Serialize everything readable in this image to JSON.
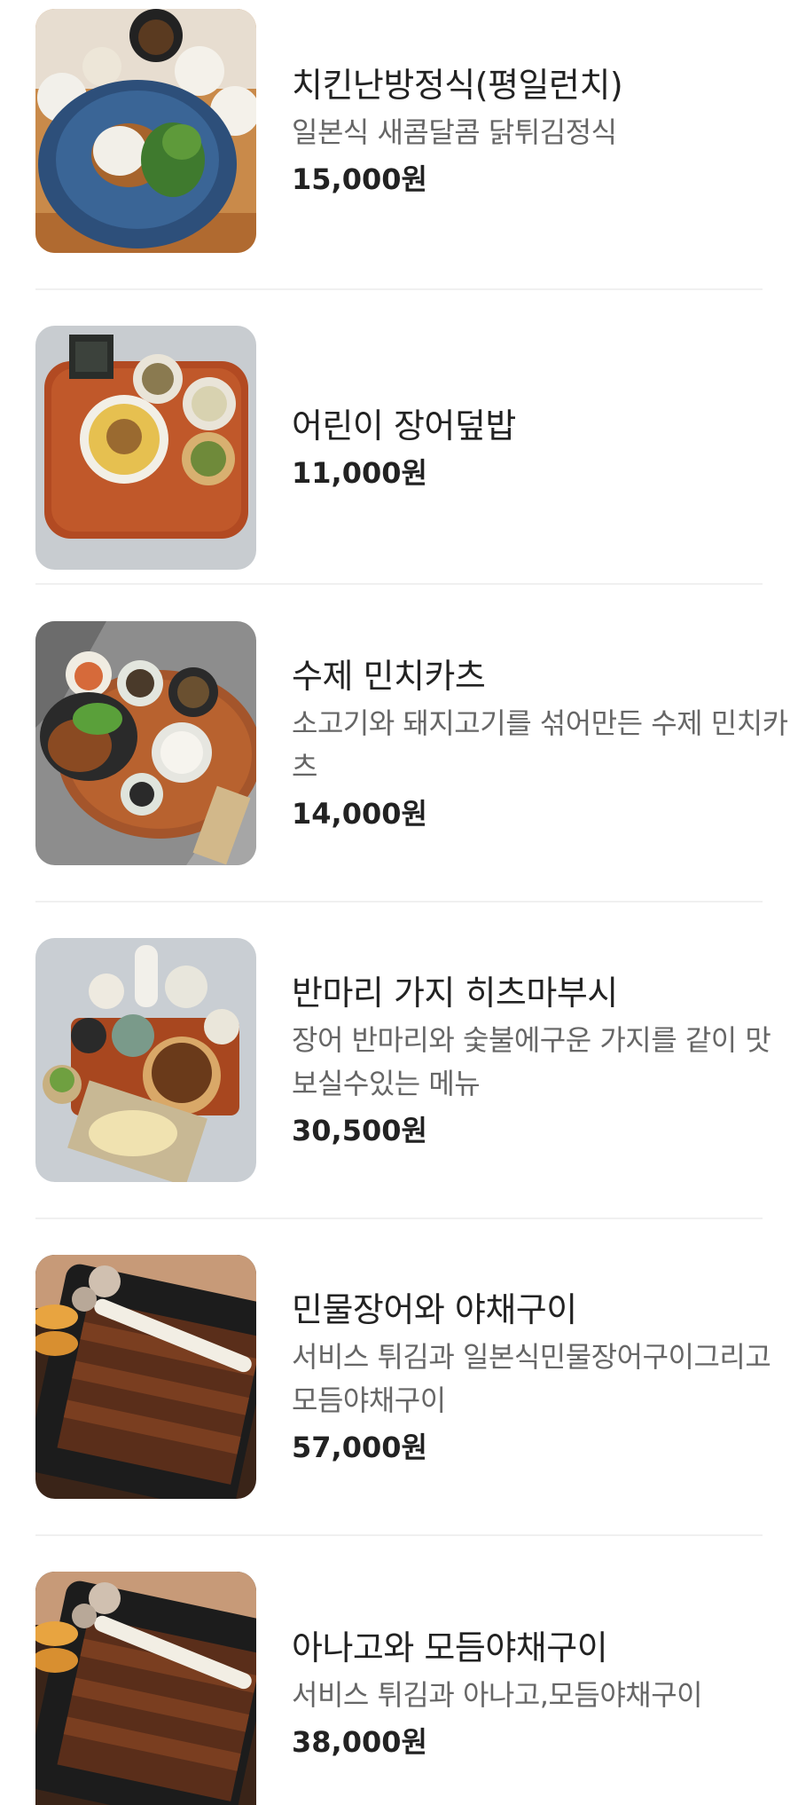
{
  "menu": {
    "items": [
      {
        "name": "치킨난방정식(평일런치)",
        "description": "일본식 새콤달콤 닭튀김정식",
        "price": "15,000원",
        "photo": "chicken-nanban-set-photo"
      },
      {
        "name": "어린이 장어덮밥",
        "description": "",
        "price": "11,000원",
        "photo": "kids-eel-rice-bowl-photo"
      },
      {
        "name": "수제 민치카츠",
        "description": "소고기와 돼지고기를 섞어만든 수제 민치카츠",
        "price": "14,000원",
        "photo": "menchi-katsu-set-photo"
      },
      {
        "name": "반마리 가지 히츠마부시",
        "description": "장어 반마리와 숯불에구운 가지를 같이 맛보실수있는 메뉴",
        "price": "30,500원",
        "photo": "half-eel-eggplant-hitsumabushi-photo"
      },
      {
        "name": "민물장어와 야채구이",
        "description": "서비스 튀김과 일본식민물장어구이그리고 모듬야채구이",
        "price": "57,000원",
        "photo": "grilled-eel-vegetables-photo"
      },
      {
        "name": "아나고와 모듬야채구이",
        "description": "서비스 튀김과 아나고,모듬야채구이",
        "price": "38,000원",
        "photo": "anago-grilled-vegetables-photo"
      }
    ]
  }
}
